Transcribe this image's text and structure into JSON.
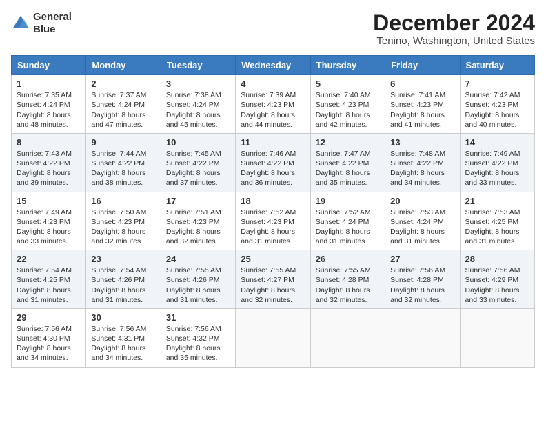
{
  "header": {
    "logo_line1": "General",
    "logo_line2": "Blue",
    "month_title": "December 2024",
    "location": "Tenino, Washington, United States"
  },
  "weekdays": [
    "Sunday",
    "Monday",
    "Tuesday",
    "Wednesday",
    "Thursday",
    "Friday",
    "Saturday"
  ],
  "weeks": [
    [
      {
        "day": "1",
        "sunrise": "7:35 AM",
        "sunset": "4:24 PM",
        "daylight": "8 hours and 48 minutes."
      },
      {
        "day": "2",
        "sunrise": "7:37 AM",
        "sunset": "4:24 PM",
        "daylight": "8 hours and 47 minutes."
      },
      {
        "day": "3",
        "sunrise": "7:38 AM",
        "sunset": "4:24 PM",
        "daylight": "8 hours and 45 minutes."
      },
      {
        "day": "4",
        "sunrise": "7:39 AM",
        "sunset": "4:23 PM",
        "daylight": "8 hours and 44 minutes."
      },
      {
        "day": "5",
        "sunrise": "7:40 AM",
        "sunset": "4:23 PM",
        "daylight": "8 hours and 42 minutes."
      },
      {
        "day": "6",
        "sunrise": "7:41 AM",
        "sunset": "4:23 PM",
        "daylight": "8 hours and 41 minutes."
      },
      {
        "day": "7",
        "sunrise": "7:42 AM",
        "sunset": "4:23 PM",
        "daylight": "8 hours and 40 minutes."
      }
    ],
    [
      {
        "day": "8",
        "sunrise": "7:43 AM",
        "sunset": "4:22 PM",
        "daylight": "8 hours and 39 minutes."
      },
      {
        "day": "9",
        "sunrise": "7:44 AM",
        "sunset": "4:22 PM",
        "daylight": "8 hours and 38 minutes."
      },
      {
        "day": "10",
        "sunrise": "7:45 AM",
        "sunset": "4:22 PM",
        "daylight": "8 hours and 37 minutes."
      },
      {
        "day": "11",
        "sunrise": "7:46 AM",
        "sunset": "4:22 PM",
        "daylight": "8 hours and 36 minutes."
      },
      {
        "day": "12",
        "sunrise": "7:47 AM",
        "sunset": "4:22 PM",
        "daylight": "8 hours and 35 minutes."
      },
      {
        "day": "13",
        "sunrise": "7:48 AM",
        "sunset": "4:22 PM",
        "daylight": "8 hours and 34 minutes."
      },
      {
        "day": "14",
        "sunrise": "7:49 AM",
        "sunset": "4:22 PM",
        "daylight": "8 hours and 33 minutes."
      }
    ],
    [
      {
        "day": "15",
        "sunrise": "7:49 AM",
        "sunset": "4:23 PM",
        "daylight": "8 hours and 33 minutes."
      },
      {
        "day": "16",
        "sunrise": "7:50 AM",
        "sunset": "4:23 PM",
        "daylight": "8 hours and 32 minutes."
      },
      {
        "day": "17",
        "sunrise": "7:51 AM",
        "sunset": "4:23 PM",
        "daylight": "8 hours and 32 minutes."
      },
      {
        "day": "18",
        "sunrise": "7:52 AM",
        "sunset": "4:23 PM",
        "daylight": "8 hours and 31 minutes."
      },
      {
        "day": "19",
        "sunrise": "7:52 AM",
        "sunset": "4:24 PM",
        "daylight": "8 hours and 31 minutes."
      },
      {
        "day": "20",
        "sunrise": "7:53 AM",
        "sunset": "4:24 PM",
        "daylight": "8 hours and 31 minutes."
      },
      {
        "day": "21",
        "sunrise": "7:53 AM",
        "sunset": "4:25 PM",
        "daylight": "8 hours and 31 minutes."
      }
    ],
    [
      {
        "day": "22",
        "sunrise": "7:54 AM",
        "sunset": "4:25 PM",
        "daylight": "8 hours and 31 minutes."
      },
      {
        "day": "23",
        "sunrise": "7:54 AM",
        "sunset": "4:26 PM",
        "daylight": "8 hours and 31 minutes."
      },
      {
        "day": "24",
        "sunrise": "7:55 AM",
        "sunset": "4:26 PM",
        "daylight": "8 hours and 31 minutes."
      },
      {
        "day": "25",
        "sunrise": "7:55 AM",
        "sunset": "4:27 PM",
        "daylight": "8 hours and 32 minutes."
      },
      {
        "day": "26",
        "sunrise": "7:55 AM",
        "sunset": "4:28 PM",
        "daylight": "8 hours and 32 minutes."
      },
      {
        "day": "27",
        "sunrise": "7:56 AM",
        "sunset": "4:28 PM",
        "daylight": "8 hours and 32 minutes."
      },
      {
        "day": "28",
        "sunrise": "7:56 AM",
        "sunset": "4:29 PM",
        "daylight": "8 hours and 33 minutes."
      }
    ],
    [
      {
        "day": "29",
        "sunrise": "7:56 AM",
        "sunset": "4:30 PM",
        "daylight": "8 hours and 34 minutes."
      },
      {
        "day": "30",
        "sunrise": "7:56 AM",
        "sunset": "4:31 PM",
        "daylight": "8 hours and 34 minutes."
      },
      {
        "day": "31",
        "sunrise": "7:56 AM",
        "sunset": "4:32 PM",
        "daylight": "8 hours and 35 minutes."
      },
      null,
      null,
      null,
      null
    ]
  ]
}
